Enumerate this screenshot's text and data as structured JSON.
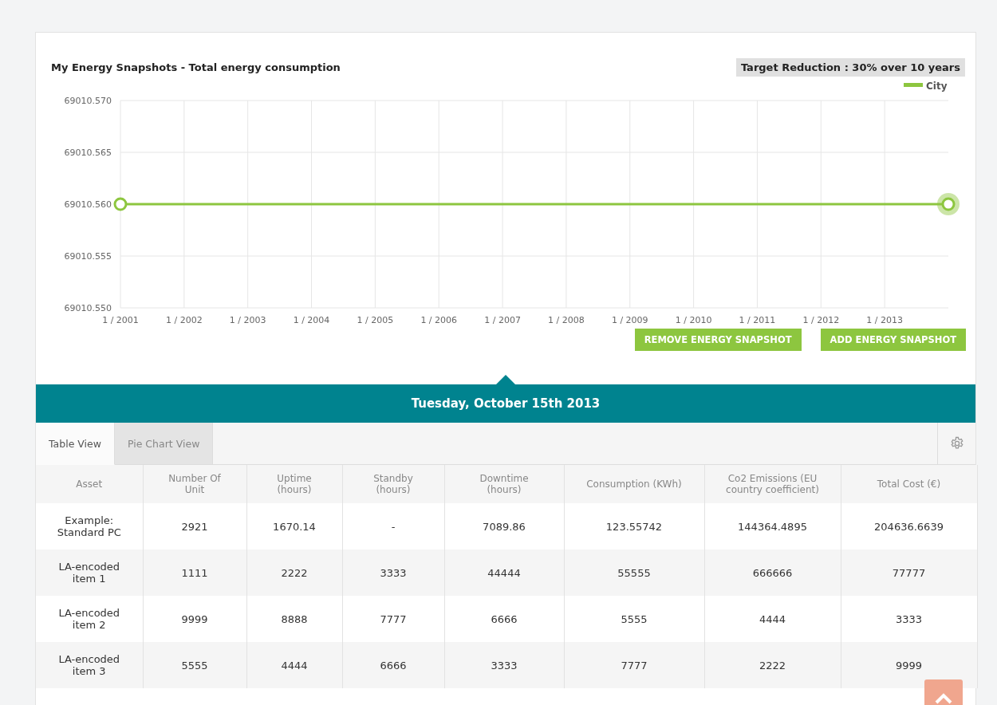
{
  "chart_panel": {
    "title": "My Energy Snapshots - Total energy consumption",
    "target_badge": "Target Reduction : 30% over 10 years",
    "chart_data": {
      "type": "line",
      "categories": [
        "1 / 2001",
        "1 / 2002",
        "1 / 2003",
        "1 / 2004",
        "1 / 2005",
        "1 / 2006",
        "1 / 2007",
        "1 / 2008",
        "1 / 2009",
        "1 / 2010",
        "1 / 2011",
        "1 / 2012",
        "1 / 2013",
        null
      ],
      "series": [
        {
          "name": "City",
          "color": "#8dc63f",
          "values": [
            69010.56,
            69010.56,
            69010.56,
            69010.56,
            69010.56,
            69010.56,
            69010.56,
            69010.56,
            69010.56,
            69010.56,
            69010.56,
            69010.56,
            69010.56,
            69010.56
          ]
        }
      ],
      "ylim": [
        69010.55,
        69010.57
      ],
      "grid": true,
      "yticks": [
        {
          "value": 69010.55,
          "label": "69010.550"
        },
        {
          "value": 69010.555,
          "label": "69010.555"
        },
        {
          "value": 69010.56,
          "label": "69010.560"
        },
        {
          "value": 69010.565,
          "label": "69010.565"
        },
        {
          "value": 69010.57,
          "label": "69010.570"
        }
      ]
    },
    "buttons": [
      "REMOVE ENERGY SNAPSHOT",
      "ADD ENERGY SNAPSHOT"
    ]
  },
  "date_banner": "Tuesday, October 15th 2013",
  "tabs": [
    {
      "label": "Table View",
      "selected": true
    },
    {
      "label": "Pie Chart View",
      "selected": false
    }
  ],
  "table": {
    "columns": [
      "Asset",
      "Number Of Unit",
      "Uptime (hours)",
      "Standby (hours)",
      "Downtime (hours)",
      "Consumption (KWh)",
      "Co2 Emissions (EU country coefficient)",
      "Total Cost (€)"
    ],
    "rows": [
      [
        "Example: Standard PC",
        "2921",
        "1670.14",
        "-",
        "7089.86",
        "123.55742",
        "144364.4895",
        "204636.6639"
      ],
      [
        "LA-encoded item 1",
        "1111",
        "2222",
        "3333",
        "44444",
        "55555",
        "666666",
        "77777"
      ],
      [
        "LA-encoded item 2",
        "9999",
        "8888",
        "7777",
        "6666",
        "5555",
        "4444",
        "3333"
      ],
      [
        "LA-encoded item 3",
        "5555",
        "4444",
        "6666",
        "3333",
        "7777",
        "2222",
        "9999"
      ]
    ]
  }
}
